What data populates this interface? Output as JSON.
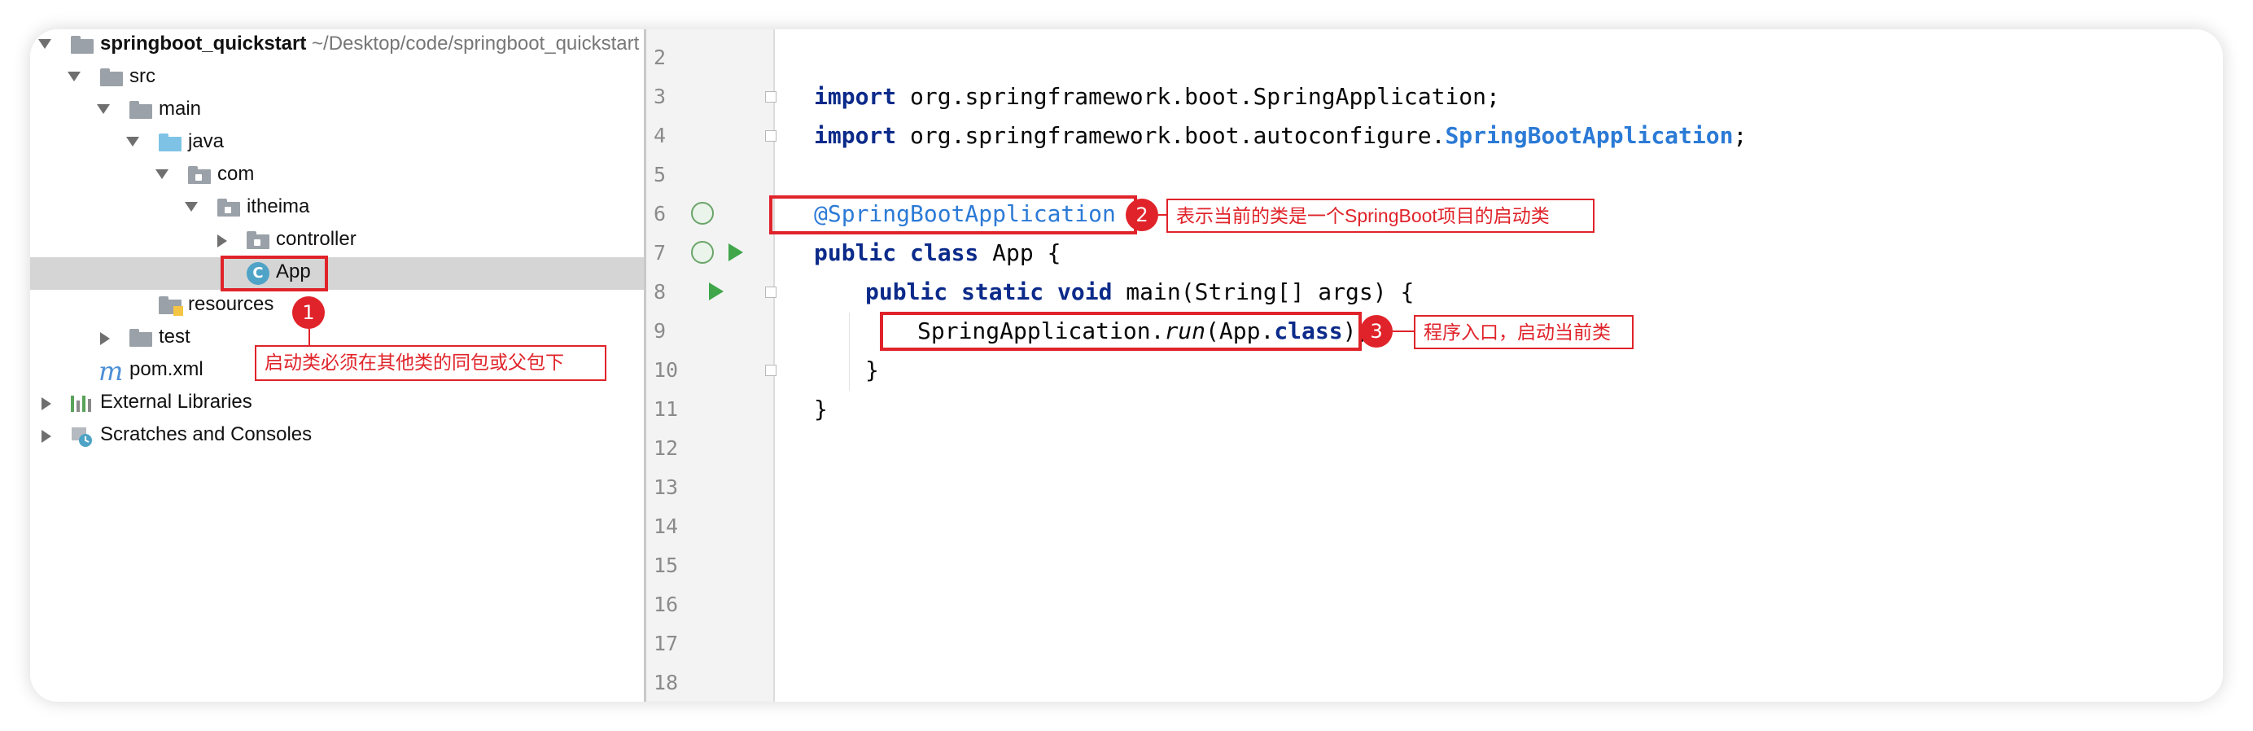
{
  "project_tree": {
    "root_name": "springboot_quickstart",
    "root_path": "~/Desktop/code/springboot_quickstart",
    "src": "src",
    "main": "main",
    "java": "java",
    "com": "com",
    "itheima": "itheima",
    "controller": "controller",
    "app": "App",
    "app_icon_letter": "C",
    "resources": "resources",
    "test": "test",
    "pom_icon": "m",
    "pom": "pom.xml",
    "external_libraries": "External Libraries",
    "scratches": "Scratches and Consoles"
  },
  "editor": {
    "line_numbers": [
      "2",
      "3",
      "4",
      "5",
      "6",
      "7",
      "8",
      "9",
      "10",
      "11",
      "12",
      "13",
      "14",
      "15",
      "16",
      "17",
      "18"
    ],
    "l3_kw": "import",
    "l3_rest": " org.springframework.boot.SpringApplication;",
    "l4_kw": "import",
    "l4_pkg": " org.springframework.boot.autoconfigure.",
    "l4_cls": "SpringBootApplication",
    "l4_end": ";",
    "l6_ann": "@SpringBootApplication",
    "l7_kw": "public class",
    "l7_rest": " App {",
    "l8_kw": "public static void",
    "l8_rest": " main(String[] args) {",
    "l9_a": "SpringApplication.",
    "l9_b": "run",
    "l9_c": "(App.",
    "l9_d": "class",
    "l9_e": ");",
    "l10": "}",
    "l11": "}"
  },
  "annotations": {
    "badge1": "1",
    "badge2": "2",
    "badge3": "3",
    "callout1": "启动类必须在其他类的同包或父包下",
    "callout2": "表示当前的类是一个SpringBoot项目的启动类",
    "callout3": "程序入口，启动当前类"
  },
  "colors": {
    "annotation_red": "#e0232a",
    "keyword": "#0b2a8a",
    "annotation_blue": "#2b7ad6",
    "selected_row": "#d5d5d5"
  }
}
